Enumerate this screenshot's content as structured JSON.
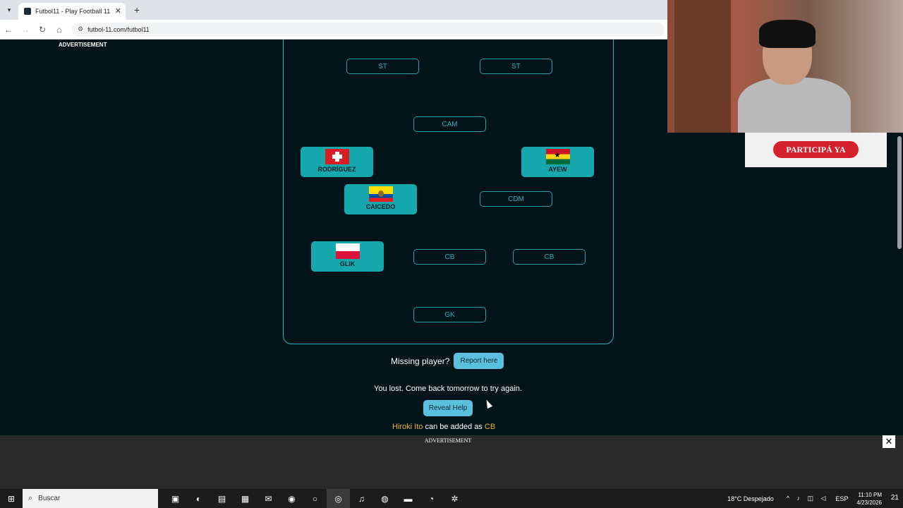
{
  "browser": {
    "tab_title": "Futbol11 - Play Football 11",
    "tab_close": "✕",
    "new_tab": "+",
    "url": "futbol-11.com/futbol11",
    "back": "←",
    "forward": "→",
    "reload": "↻",
    "home": "⌂"
  },
  "page": {
    "advertisement_top": "ADVERTISEMENT",
    "positions": {
      "st_left": "ST",
      "st_right": "ST",
      "cam": "CAM",
      "cdm": "CDM",
      "cb_left": "CB",
      "cb_right": "CB",
      "gk": "GK"
    },
    "players": {
      "rodriguez": {
        "name": "RODRÍGUEZ",
        "flag": "switzerland-flag"
      },
      "ayew": {
        "name": "AYEW",
        "flag": "ghana-flag"
      },
      "caicedo": {
        "name": "CAICEDO",
        "flag": "ecuador-flag"
      },
      "glik": {
        "name": "GLIK",
        "flag": "poland-flag"
      }
    },
    "missing_text": "Missing player?",
    "report_button": "Report here",
    "lost_message": "You lost. Come back tomorrow to try again.",
    "reveal_button": "Reveal Help",
    "hint": {
      "player": "Hiroki Ito",
      "middle": " can be added as ",
      "position": "CB"
    },
    "advertisement_bottom": "ADVERTISEMENT",
    "ad_close": "✕"
  },
  "overlay": {
    "promo_button": "PARTICIPÁ YA"
  },
  "taskbar": {
    "search_placeholder": "Buscar",
    "weather": "18°C  Despejado",
    "language": "ESP",
    "time": "11:10 PM",
    "date": "4/23/2026",
    "notification_count": "21"
  },
  "colors": {
    "page_bg": "#02131a",
    "accent_teal": "#17a8ad",
    "button_blue": "#5bc0de",
    "hint_gold": "#f0b429"
  }
}
